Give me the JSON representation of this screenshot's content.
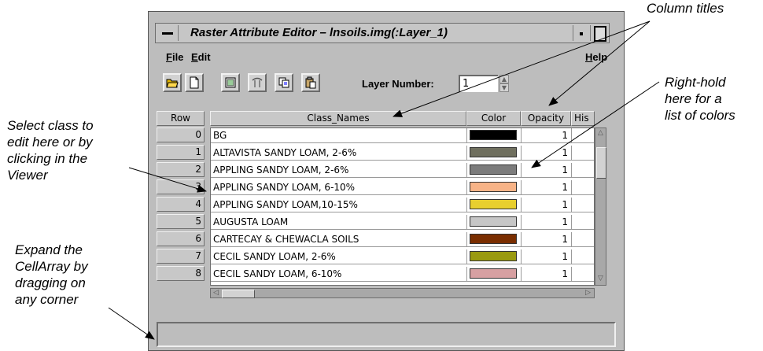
{
  "annotations": {
    "column_titles": "Column titles",
    "right_hold": [
      "Right-hold",
      "here for a",
      "list of colors"
    ],
    "select_class": [
      "Select class to",
      "edit here or by",
      "clicking in the",
      "Viewer"
    ],
    "expand": [
      "Expand the",
      "CellArray by",
      "dragging on",
      "any corner"
    ]
  },
  "window": {
    "title": "Raster Attribute Editor – lnsoils.img(:Layer_1)",
    "menus": {
      "file": "File",
      "file_underline": "F",
      "file_rest": "ile",
      "edit": "Edit",
      "edit_underline": "E",
      "edit_rest": "dit",
      "help": "Help",
      "help_underline": "H",
      "help_rest": "elp"
    },
    "toolbar": {
      "icons": [
        "open-folder-icon",
        "new-document-icon",
        "image-icon",
        "column-properties-icon",
        "copy-icon",
        "paste-icon"
      ],
      "layer_label": "Layer Number:",
      "layer_value": "1"
    }
  },
  "table": {
    "headers": {
      "row": "Row",
      "class_names": "Class_Names",
      "color": "Color",
      "opacity": "Opacity",
      "histogram": "His"
    },
    "rows": [
      {
        "row": "0",
        "name": "BG",
        "color": "#000000",
        "opacity": "1"
      },
      {
        "row": "1",
        "name": "ALTAVISTA SANDY LOAM, 2-6%",
        "color": "#6f6f5e",
        "opacity": "1"
      },
      {
        "row": "2",
        "name": "APPLING SANDY LOAM, 2-6%",
        "color": "#7c7c7c",
        "opacity": "1"
      },
      {
        "row": "3",
        "name": "APPLING SANDY LOAM, 6-10%",
        "color": "#f7b387",
        "opacity": "1"
      },
      {
        "row": "4",
        "name": "APPLING SANDY LOAM,10-15%",
        "color": "#e8cf2f",
        "opacity": "1"
      },
      {
        "row": "5",
        "name": "AUGUSTA LOAM",
        "color": "#c6c6c6",
        "opacity": "1"
      },
      {
        "row": "6",
        "name": "CARTECAY & CHEWACLA SOILS",
        "color": "#7a2e00",
        "opacity": "1"
      },
      {
        "row": "7",
        "name": "CECIL SANDY LOAM, 2-6%",
        "color": "#9a9a10",
        "opacity": "1"
      },
      {
        "row": "8",
        "name": "CECIL SANDY LOAM, 6-10%",
        "color": "#d7a0a2",
        "opacity": "1"
      }
    ]
  }
}
